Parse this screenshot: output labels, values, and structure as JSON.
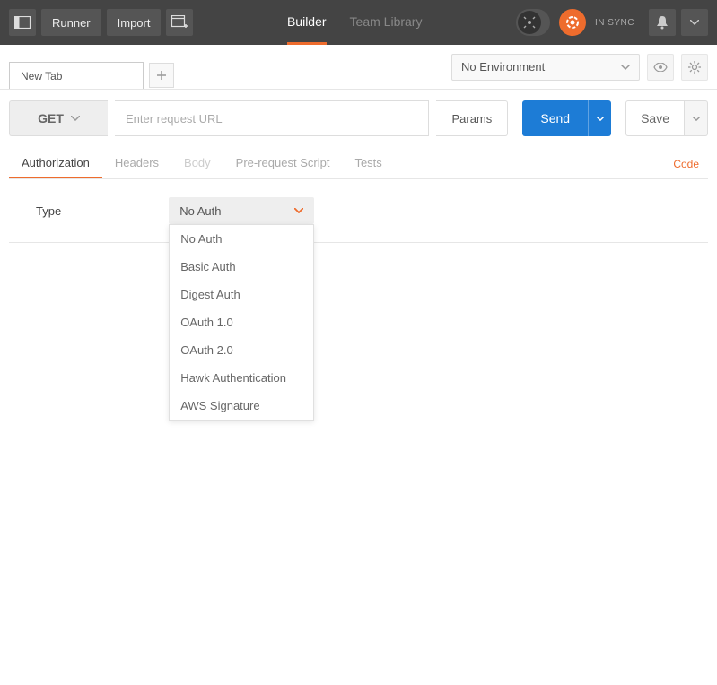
{
  "topbar": {
    "runner": "Runner",
    "import": "Import",
    "builder": "Builder",
    "team_library": "Team Library",
    "sync_status": "IN SYNC"
  },
  "subbar": {
    "tab_label": "New Tab",
    "environment": "No Environment"
  },
  "request": {
    "method": "GET",
    "url_placeholder": "Enter request URL",
    "params": "Params",
    "send": "Send",
    "save": "Save"
  },
  "req_tabs": {
    "authorization": "Authorization",
    "headers": "Headers",
    "body": "Body",
    "prerequest": "Pre-request Script",
    "tests": "Tests",
    "code": "Code"
  },
  "auth": {
    "type_label": "Type",
    "selected": "No Auth",
    "options": [
      "No Auth",
      "Basic Auth",
      "Digest Auth",
      "OAuth 1.0",
      "OAuth 2.0",
      "Hawk Authentication",
      "AWS Signature"
    ]
  }
}
